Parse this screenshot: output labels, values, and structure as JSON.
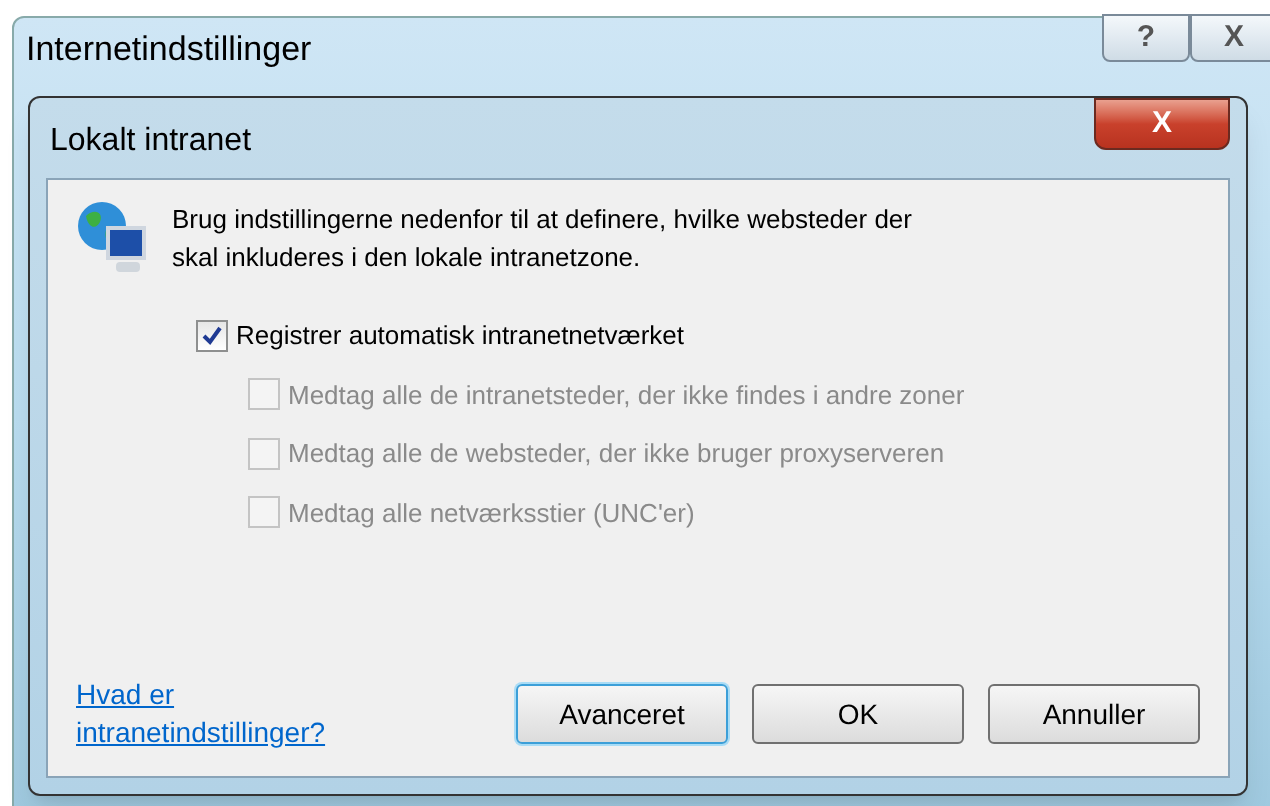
{
  "parent_window": {
    "title": "Internetindstillinger",
    "controls": [
      "?",
      "X"
    ]
  },
  "dialog": {
    "title": "Lokalt intranet",
    "close": "X",
    "description": "Brug indstillingerne nedenfor til at definere, hvilke websteder der skal inkluderes i den lokale intranetzone.",
    "options": [
      {
        "label": "Registrer automatisk intranetnetværket",
        "checked": true,
        "disabled": false,
        "nested": false
      },
      {
        "label": "Medtag alle de intranetsteder, der ikke findes i andre zoner",
        "checked": false,
        "disabled": true,
        "nested": true
      },
      {
        "label": "Medtag alle de websteder, der ikke bruger proxyserveren",
        "checked": false,
        "disabled": true,
        "nested": true
      },
      {
        "label": "Medtag alle netværksstier (UNC'er)",
        "checked": false,
        "disabled": true,
        "nested": true
      }
    ],
    "help_link": "Hvad er intranetindstillinger?",
    "buttons": [
      {
        "label": "Avanceret",
        "focused": true
      },
      {
        "label": "OK",
        "focused": false
      },
      {
        "label": "Annuller",
        "focused": false
      }
    ]
  }
}
